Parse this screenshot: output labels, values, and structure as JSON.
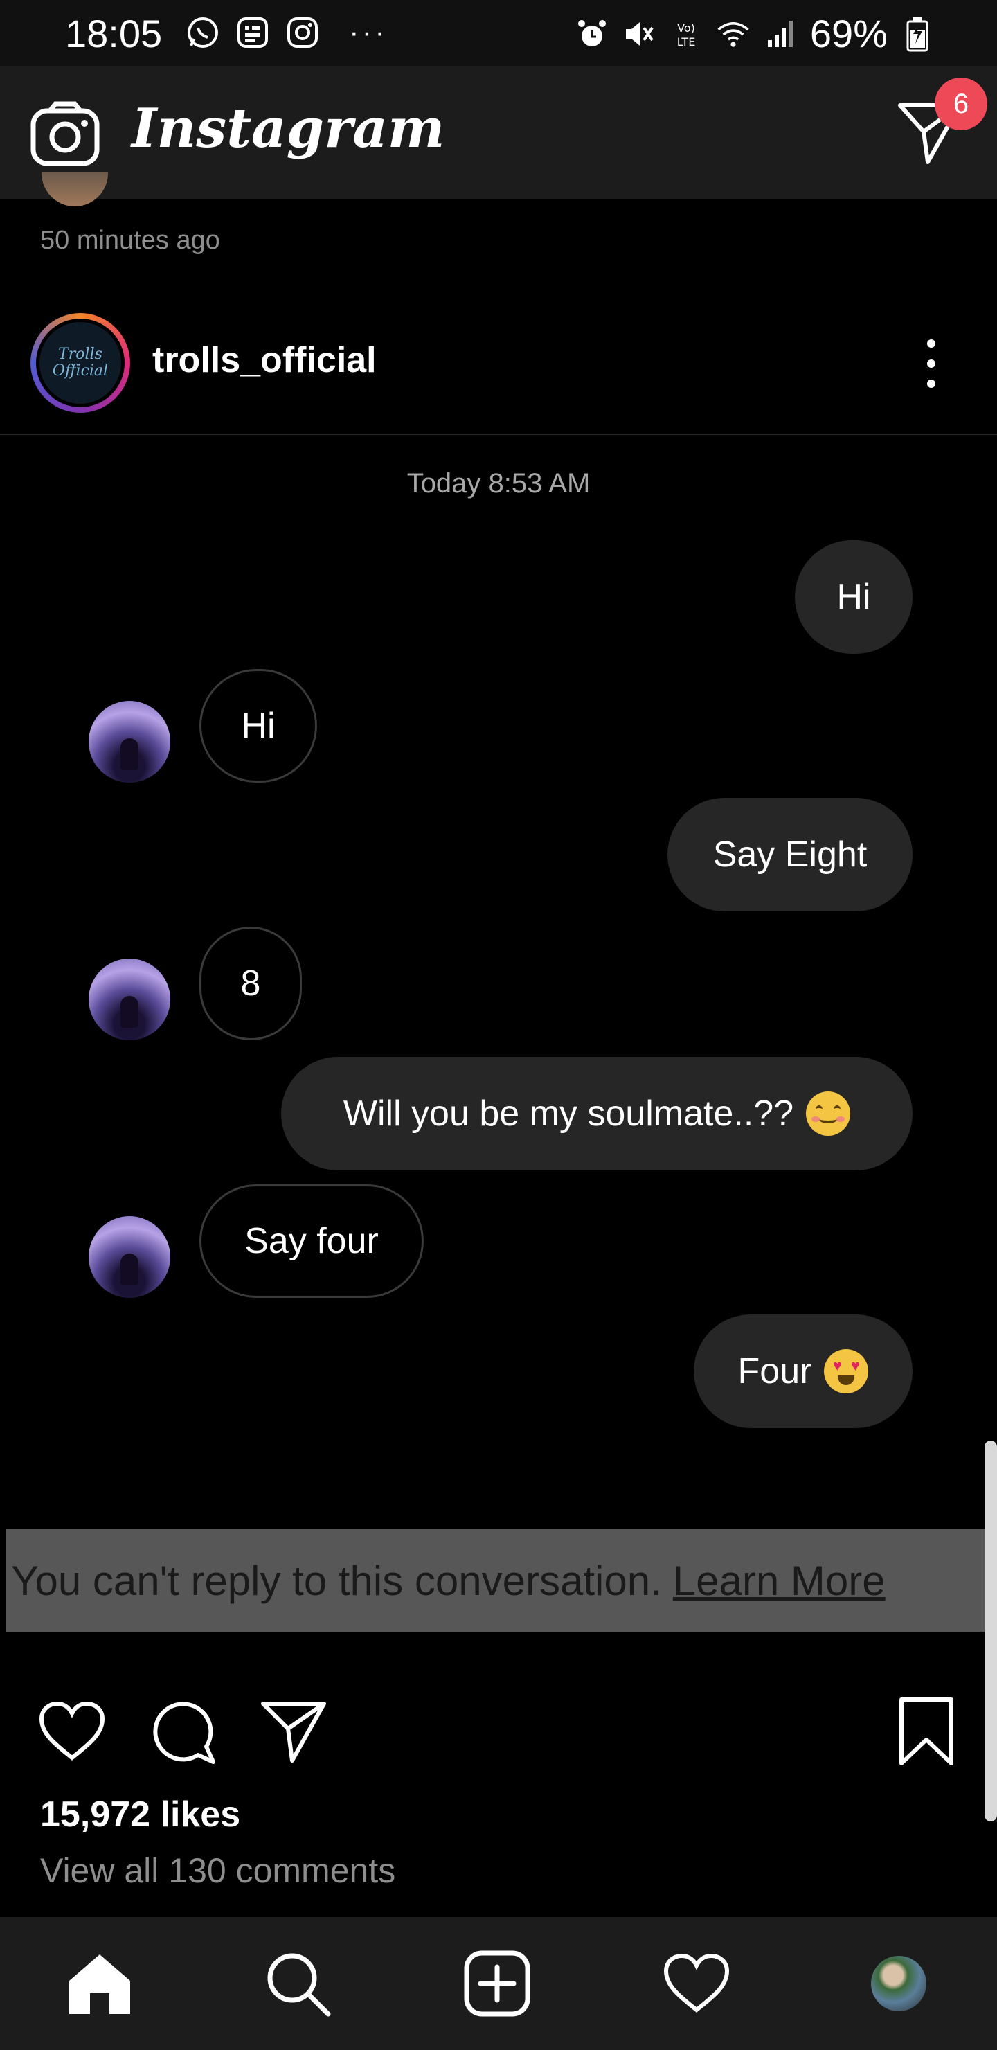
{
  "status_bar": {
    "time": "18:05",
    "battery": "69%",
    "left_icons": [
      "whatsapp-icon",
      "sms-icon",
      "instagram-icon"
    ],
    "more": "···"
  },
  "app_header": {
    "title": "Instagram",
    "dm_badge": "6"
  },
  "post": {
    "previous_time_ago": "50 minutes ago",
    "username": "trolls_official",
    "avatar_text": "Trolls Official",
    "conversation": {
      "timestamp": "Today 8:53 AM",
      "messages": [
        {
          "from": "me",
          "text": "Hi"
        },
        {
          "from": "them",
          "text": "Hi"
        },
        {
          "from": "me",
          "text": "Say Eight"
        },
        {
          "from": "them",
          "text": "8"
        },
        {
          "from": "me",
          "text": "Will you be my soulmate..??",
          "emoji": "smiling-face-emoji"
        },
        {
          "from": "them",
          "text": "Say four"
        },
        {
          "from": "me",
          "text": "Four",
          "emoji": "heart-eyes-emoji"
        }
      ],
      "no_reply_text": "You can't reply to this conversation.",
      "learn_more": "Learn More"
    },
    "likes": "15,972 likes",
    "view_comments": "View all 130 comments"
  },
  "colors": {
    "background": "#000000",
    "header": "#1c1c1c",
    "sent_bubble": "#262626",
    "badge": "#ed4956",
    "secondary_text": "#8e8e8e"
  }
}
